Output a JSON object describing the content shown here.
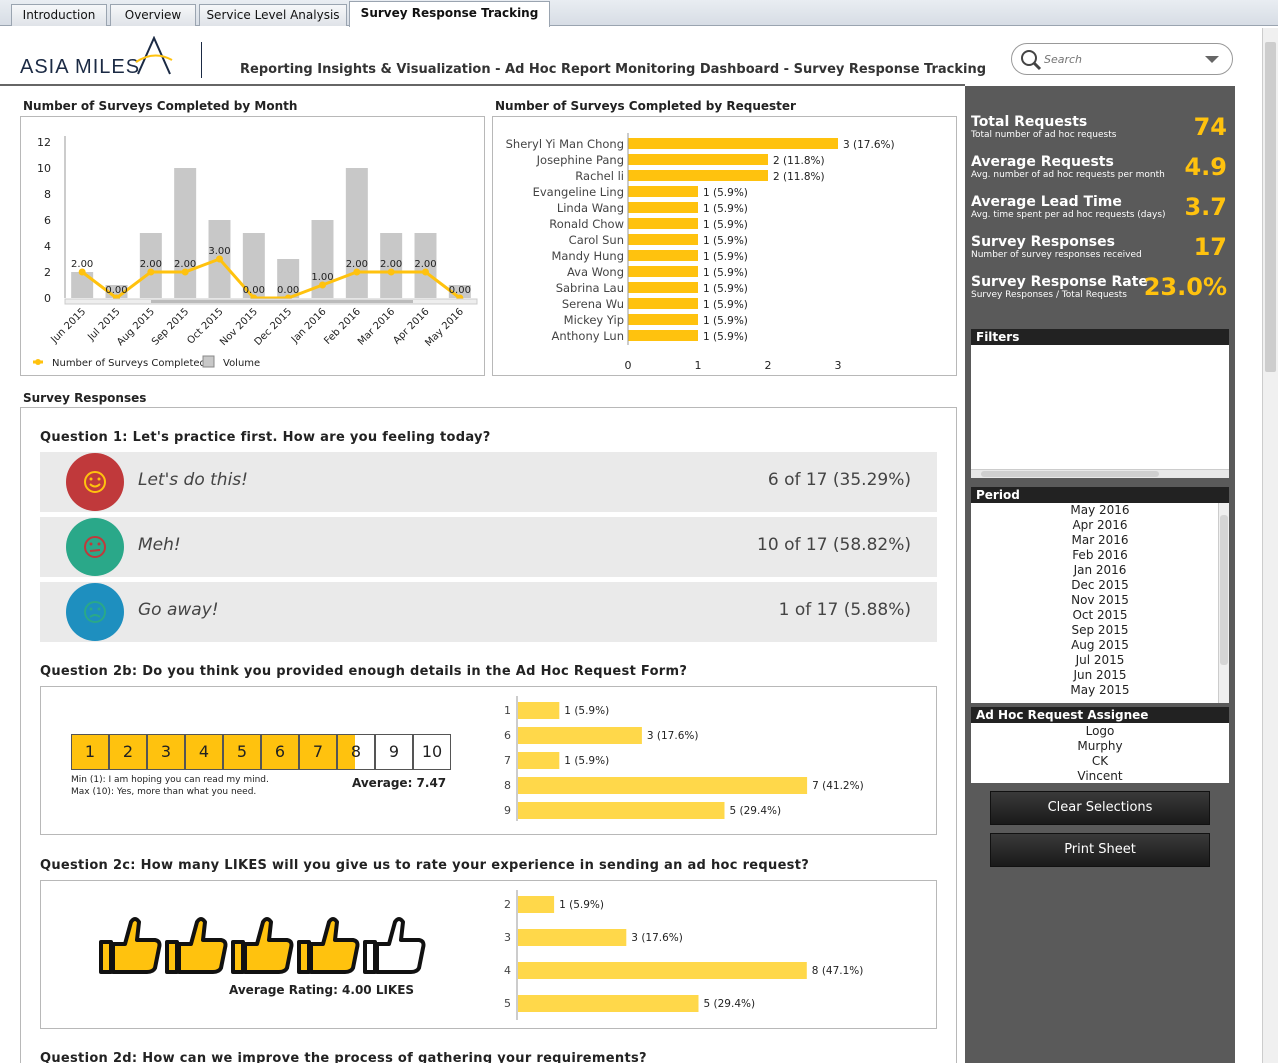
{
  "tabs": [
    {
      "label": "Introduction",
      "active": false
    },
    {
      "label": "Overview",
      "active": false
    },
    {
      "label": "Service Level Analysis",
      "active": false
    },
    {
      "label": "Survey Response Tracking",
      "active": true
    }
  ],
  "header": {
    "logo_text": "ASIA MILES",
    "title": "Reporting Insights & Visualization - Ad Hoc Report Monitoring Dashboard - Survey Response Tracking"
  },
  "search": {
    "placeholder": "Search"
  },
  "month_chart_title": "Number of Surveys Completed by Month",
  "requester_chart_title": "Number of Surveys Completed by Requester",
  "survey_section_title": "Survey Responses",
  "chart_data": [
    {
      "type": "bar",
      "categories": [
        "Jun 2015",
        "Jul 2015",
        "Aug 2015",
        "Sep 2015",
        "Oct 2015",
        "Nov 2015",
        "Dec 2015",
        "Jan 2016",
        "Feb 2016",
        "Mar 2016",
        "Apr 2016",
        "May 2016"
      ],
      "series": [
        {
          "name": "Volume",
          "values": [
            2,
            1,
            5,
            10,
            6,
            5,
            3,
            6,
            10,
            5,
            5,
            1
          ]
        },
        {
          "name": "Number of Surveys Completed",
          "type": "line",
          "values": [
            2,
            0,
            2,
            2,
            3,
            0,
            0,
            1,
            2,
            2,
            2,
            0
          ],
          "labels": [
            "2.00",
            "0.00",
            "2.00",
            "2.00",
            "3.00",
            "0.00",
            "0.00",
            "1.00",
            "2.00",
            "2.00",
            "2.00",
            "0.00"
          ]
        }
      ],
      "ylim": [
        0,
        12
      ],
      "yticks": [
        "0",
        "2",
        "4",
        "6",
        "8",
        "10",
        "12"
      ],
      "legend": "bottom",
      "colors": {
        "bar": "#c8c8c8",
        "line": "#ffc20e"
      }
    },
    {
      "type": "bar",
      "orientation": "horizontal",
      "categories": [
        "Sheryl Yi Man Chong",
        "Josephine Pang",
        "Rachel li",
        "Evangeline Ling",
        "Linda Wang",
        "Ronald Chow",
        "Carol Sun",
        "Mandy Hung",
        "Ava Wong",
        "Sabrina Lau",
        "Serena Wu",
        "Mickey Yip",
        "Anthony Lun"
      ],
      "values": [
        3,
        2,
        2,
        1,
        1,
        1,
        1,
        1,
        1,
        1,
        1,
        1,
        1
      ],
      "labels": [
        "3  (17.6%)",
        "2  (11.8%)",
        "2  (11.8%)",
        "1  (5.9%)",
        "1  (5.9%)",
        "1  (5.9%)",
        "1  (5.9%)",
        "1  (5.9%)",
        "1  (5.9%)",
        "1  (5.9%)",
        "1  (5.9%)",
        "1  (5.9%)",
        "1  (5.9%)"
      ],
      "xlim": [
        0,
        3
      ],
      "xticks": [
        "0",
        "1",
        "2",
        "3"
      ],
      "colors": {
        "bar": "#ffc20e"
      }
    },
    {
      "type": "bar",
      "orientation": "horizontal",
      "categories": [
        "1",
        "6",
        "7",
        "8",
        "9"
      ],
      "values": [
        1,
        3,
        1,
        7,
        5
      ],
      "labels": [
        "1  (5.9%)",
        "3  (17.6%)",
        "1  (5.9%)",
        "7  (41.2%)",
        "5  (29.4%)"
      ],
      "xlim": [
        0,
        7
      ],
      "colors": {
        "bar": "#ffd84a"
      }
    },
    {
      "type": "bar",
      "orientation": "horizontal",
      "categories": [
        "2",
        "3",
        "4",
        "5"
      ],
      "values": [
        1,
        3,
        8,
        5
      ],
      "labels": [
        "1  (5.9%)",
        "3  (17.6%)",
        "8  (47.1%)",
        "5  (29.4%)"
      ],
      "xlim": [
        0,
        8
      ],
      "colors": {
        "bar": "#ffd84a"
      }
    }
  ],
  "legend": {
    "line": "Number of Surveys Completed",
    "bar": "Volume"
  },
  "q1": {
    "title": "Question 1: Let's practice first. How are you feeling today?",
    "rows": [
      {
        "label": "Let's do this!",
        "count": "6 of 17 (35.29%)",
        "color": "#c0393b",
        "icon": "smile-face-icon"
      },
      {
        "label": "Meh!",
        "count": "10 of 17 (58.82%)",
        "color": "#2aa889",
        "icon": "neutral-face-icon"
      },
      {
        "label": "Go away!",
        "count": "1 of 17 (5.88%)",
        "color": "#1e8fbf",
        "icon": "sad-face-icon"
      }
    ]
  },
  "q2b": {
    "title": "Question 2b: Do you think you provided enough details in the Ad Hoc Request Form?",
    "scale": [
      "1",
      "2",
      "3",
      "4",
      "5",
      "6",
      "7",
      "8",
      "9",
      "10"
    ],
    "average_value": 7.47,
    "average_label": "Average: 7.47",
    "min_text": "Min (1): I am hoping you can read my mind.",
    "max_text": "Max (10): Yes, more than what you need."
  },
  "q2c": {
    "title": "Question 2c: How many LIKES will you give us to rate your experience in sending an ad hoc request?",
    "rating_value": 4,
    "rating_max": 5,
    "average_label": "Average Rating: 4.00 LIKES"
  },
  "q2d": {
    "title": "Question 2d: How can we improve the process of gathering your requirements?"
  },
  "kpis": [
    {
      "label": "Total Requests",
      "sub": "Total number of ad hoc requests",
      "value": "74"
    },
    {
      "label": "Average Requests",
      "sub": "Avg. number of ad hoc requests per month",
      "value": "4.9"
    },
    {
      "label": "Average Lead Time",
      "sub": "Avg. time spent per ad hoc requests (days)",
      "value": "3.7"
    },
    {
      "label": "Survey Responses",
      "sub": "Number of survey responses received",
      "value": "17"
    },
    {
      "label": "Survey Response Rate",
      "sub": "Survey Responses / Total Requests",
      "value": "23.0%"
    }
  ],
  "filters": {
    "title": "Filters"
  },
  "period": {
    "title": "Period",
    "items": [
      "May 2016",
      "Apr 2016",
      "Mar 2016",
      "Feb 2016",
      "Jan 2016",
      "Dec 2015",
      "Nov 2015",
      "Oct 2015",
      "Sep 2015",
      "Aug 2015",
      "Jul 2015",
      "Jun 2015",
      "May 2015"
    ]
  },
  "assignee": {
    "title": "Ad Hoc Request Assignee",
    "items": [
      "Logo",
      "Murphy",
      "CK",
      "Vincent"
    ]
  },
  "buttons": {
    "clear": "Clear Selections",
    "print": "Print Sheet"
  }
}
